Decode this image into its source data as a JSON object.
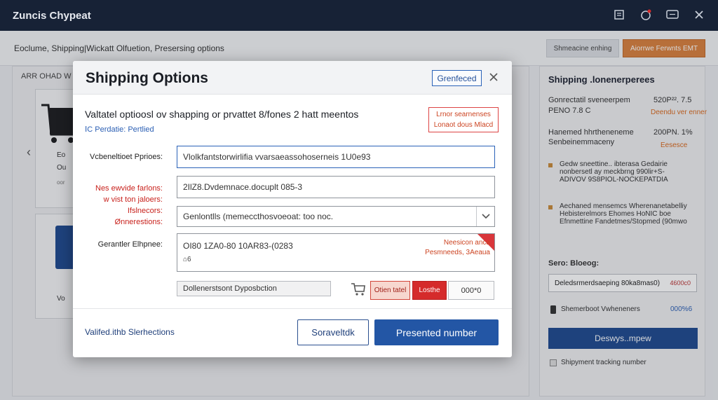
{
  "app": {
    "title": "Zuncis Chypeat"
  },
  "page": {
    "breadcrumb": "Eoclume, Shipping|Wickatt Olfuetion, Presersing options",
    "btn_secondary": "Shmeacine enhing",
    "btn_primary": "Aiorrwe Ferwnts EMT",
    "left_panel": {
      "title": "ARR OHAD W",
      "items": [
        "Eo",
        "Ou",
        "Vo"
      ],
      "tags": [
        "oor"
      ]
    },
    "right_panel": {
      "title": "Shipping .lonenerperees",
      "row1_label": "Gonrectatil sveneerpem",
      "row1_value": "520P²². 7.5",
      "row1_sub": "PENO 7.8 C",
      "row1_orange": "Deendu ver enner",
      "row2_label": "Hanemed hhrtheneneme",
      "row2_value": "200PN. 1%",
      "row2_sub": "Senbeinemmaceny",
      "row2_orange": "Eesesce",
      "note1": "Gedw sneettine.. ibterasa Gedairie nonbersetl ay meckbrng 990lir+S-ADIVOV 9S8PIOL-NOCKEPATDIA",
      "note2": "Aechaned mensemcs Wherenanetabelliy Hebisterelmors Ehomes HoNIC boe Efnmettine Fandetmes/Stopmed (90mwo",
      "select_label": "Sero: Bloeog:",
      "select_value": "Deledsrmerdsaeping 80ka8mas0)",
      "select_red": "4600c0",
      "row3_label": "Shemerboot Vwheneners",
      "row3_value": "000%6",
      "blue_button": "Deswys..mpew",
      "tracking_label": "Shipyment tracking number"
    }
  },
  "modal": {
    "title": "Shipping  Options",
    "badge": "Grenfeced",
    "subtitle": "Valtatel optioosl ov shapping or prvattet 8/fones 2 hatt meentos",
    "link": "ⅠC Perdatie: Pertlied",
    "note_box": "Lrnor searnenses Lonaot dous Mlacd",
    "fields": {
      "f1_label": "Vcbeneltioet Pprioes:",
      "f1_value": "Vlolkfantstorwirlifia vvarsaeassohoserneis 1U0e93",
      "f2_label_lines": [
        "Nes ewvide farlons:",
        "w vist ton jaloers:",
        "Ifslnecors:",
        "Ønnerestions:"
      ],
      "f2_value": "2IlZ8.Dvdemnace.docuplt 085-3",
      "f3_value": "Genlontlls (memeccthosvoeoat: too noc.",
      "f4_label": "Gerantler Elhpnee:",
      "f4_value": "OI80 1ZA0-80 10AR83-(0283",
      "f4_tag": "⌂6",
      "f4_warn": "Neesicon anca Pesmneeds, 3Aeaua",
      "doc_value": "Dollenerstsont Dyposbction",
      "btn_a": "Otien tatel",
      "btn_b": "Losthe",
      "btn_c": "000*0"
    },
    "footer": {
      "link": "Valifed.ithb Slerhections",
      "secondary": "Soraveltdk",
      "primary": "Presented number"
    }
  },
  "colors": {
    "topbar": "#172236",
    "accent_blue": "#2356a5",
    "alert_red": "#d52b2b",
    "orange": "#d9803d"
  }
}
